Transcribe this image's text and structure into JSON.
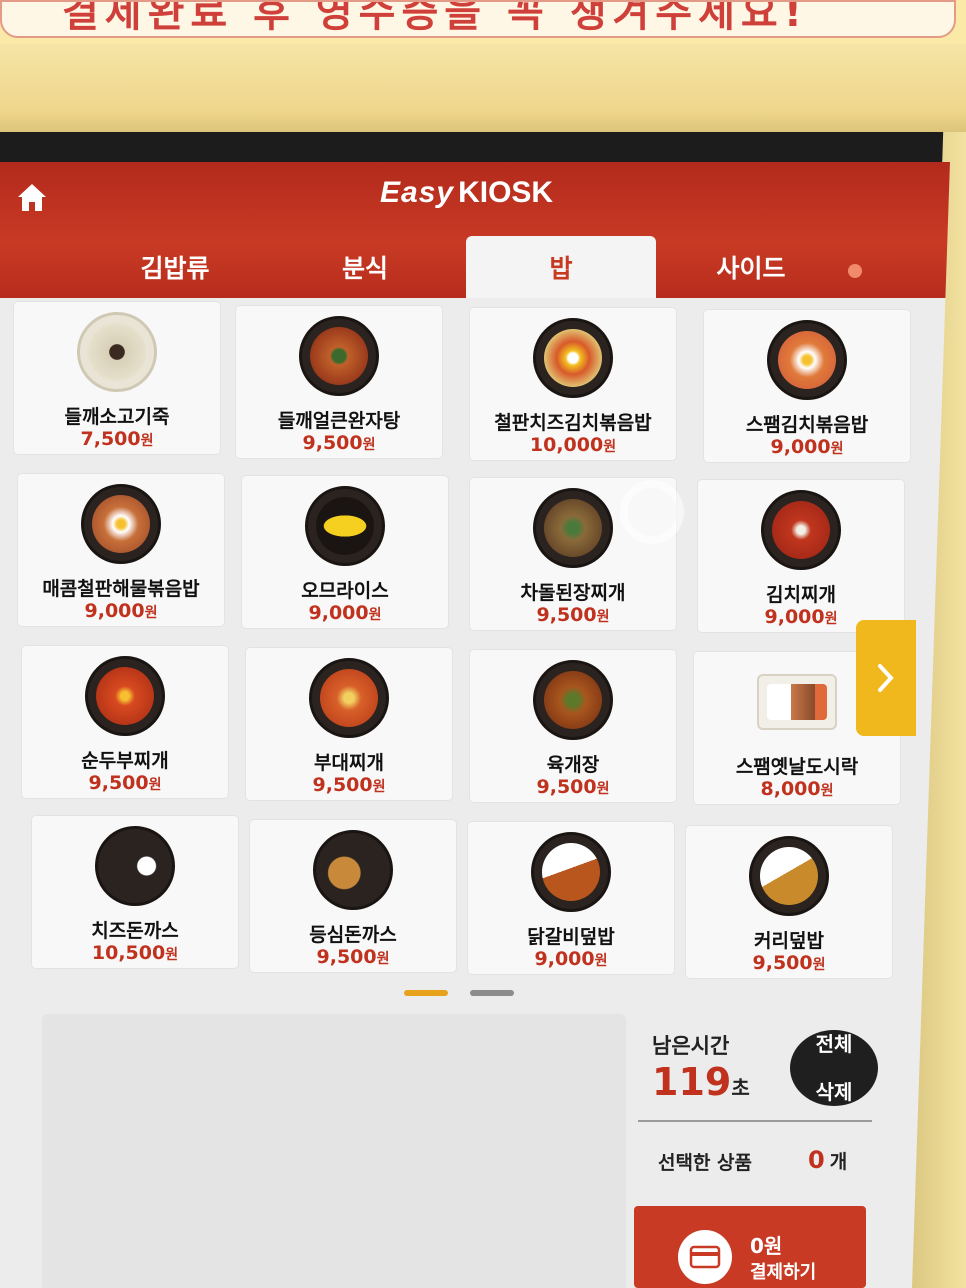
{
  "sign": {
    "text": "결제완료 후 영수증을 꼭 챙겨주세요!"
  },
  "header": {
    "brand_easy": "Easy",
    "brand_kiosk": "KIOSK",
    "home_icon": "home-icon"
  },
  "tabs": [
    {
      "label": "김밥류"
    },
    {
      "label": "분식"
    },
    {
      "label": "밥",
      "active": true
    },
    {
      "label": "사이드"
    }
  ],
  "currency": "원",
  "menu": [
    {
      "name": "들깨소고기죽",
      "price": "7,500"
    },
    {
      "name": "들깨얼큰완자탕",
      "price": "9,500"
    },
    {
      "name": "철판치즈김치볶음밥",
      "price": "10,000"
    },
    {
      "name": "스팸김치볶음밥",
      "price": "9,000"
    },
    {
      "name": "매콤철판해물볶음밥",
      "price": "9,000"
    },
    {
      "name": "오므라이스",
      "price": "9,000"
    },
    {
      "name": "차돌된장찌개",
      "price": "9,500"
    },
    {
      "name": "김치찌개",
      "price": "9,000"
    },
    {
      "name": "순두부찌개",
      "price": "9,500"
    },
    {
      "name": "부대찌개",
      "price": "9,500"
    },
    {
      "name": "육개장",
      "price": "9,500"
    },
    {
      "name": "스팸옛날도시락",
      "price": "8,000"
    },
    {
      "name": "치즈돈까스",
      "price": "10,500"
    },
    {
      "name": "등심돈까스",
      "price": "9,500"
    },
    {
      "name": "닭갈비덮밥",
      "price": "9,000"
    },
    {
      "name": "커리덮밥",
      "price": "9,500"
    }
  ],
  "pagination": {
    "current": 1,
    "total": 2
  },
  "summary": {
    "time_label": "남은시간",
    "time_value": "119",
    "time_unit": "초",
    "clear_label_1": "전체",
    "clear_label_2": "삭제",
    "selected_label": "선택한 상품",
    "selected_count": "0",
    "selected_unit": "개",
    "pay_amount": "0원",
    "pay_label": "결제하기"
  },
  "colors": {
    "header_red": "#c83a24",
    "price_red": "#c0321e",
    "next_yellow": "#f0b81c",
    "pager_active": "#e8a11a",
    "pager_inactive": "#8c8c8c"
  }
}
